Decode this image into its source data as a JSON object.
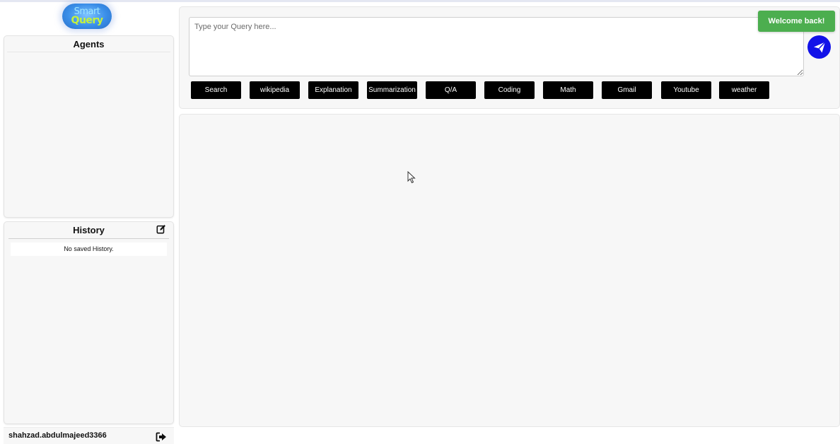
{
  "logo": {
    "line1": "Smart",
    "line2": "Query"
  },
  "agents": {
    "title": "Agents"
  },
  "history": {
    "title": "History",
    "empty_text": "No saved History.",
    "edit_icon": "edit-icon"
  },
  "user": {
    "name": "shahzad.abdulmajeed3366",
    "logout_icon": "logout-icon"
  },
  "query": {
    "placeholder": "Type your Query here...",
    "value": "",
    "send_icon": "paper-plane-icon"
  },
  "agent_buttons": [
    "Search",
    "wikipedia",
    "Explanation",
    "Summarization",
    "Q/A",
    "Coding",
    "Math",
    "Gmail",
    "Youtube",
    "weather"
  ],
  "toast": {
    "text": "Welcome back!"
  },
  "colors": {
    "send_button": "#1212e8",
    "agent_button_bg": "#000000",
    "toast_bg": "#4cae4f",
    "panel_bg": "#f7f7f7"
  }
}
